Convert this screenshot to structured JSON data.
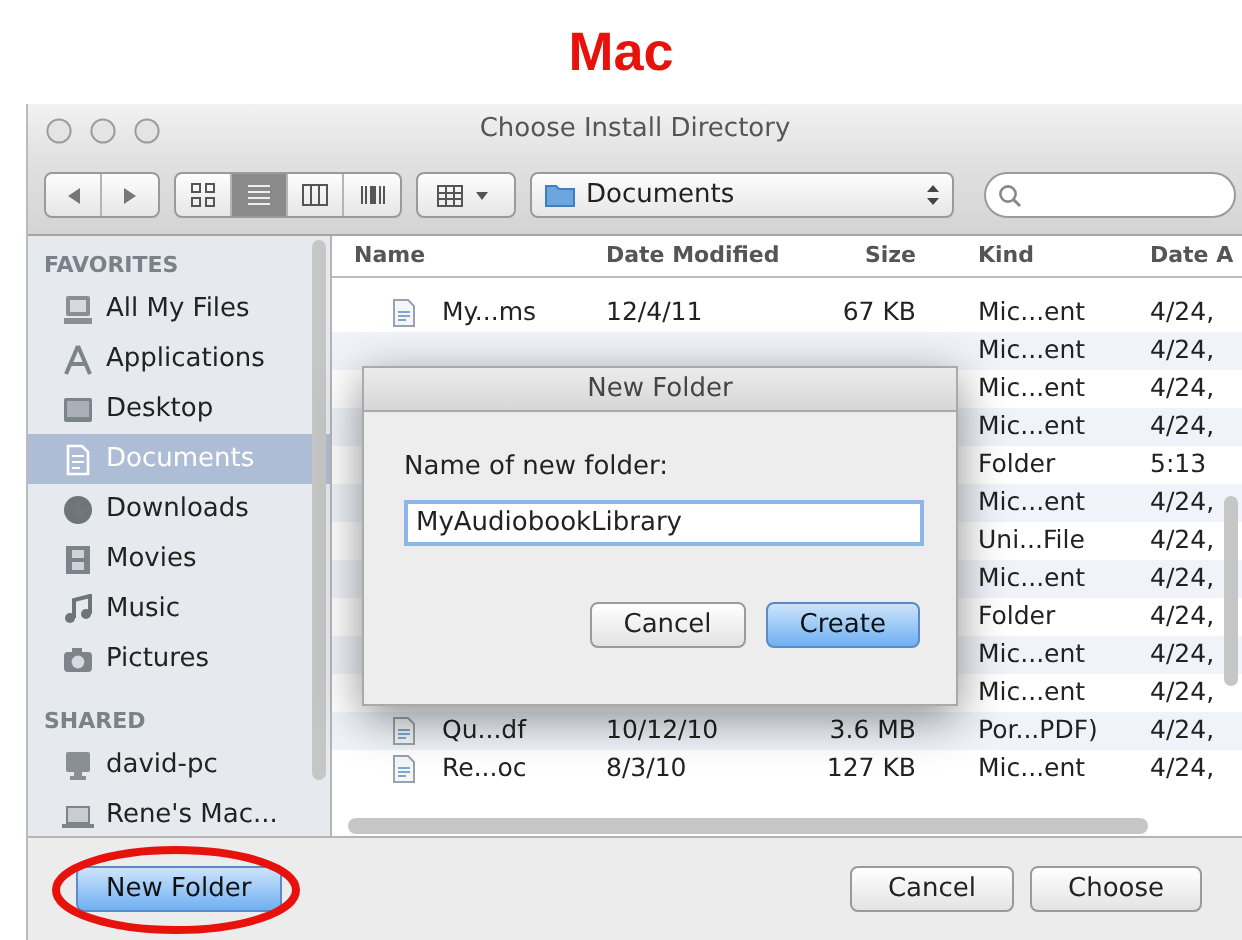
{
  "annotation": {
    "title": "Mac"
  },
  "window": {
    "title": "Choose Install Directory"
  },
  "toolbar": {
    "views": [
      {
        "selected": false
      },
      {
        "selected": true
      },
      {
        "selected": false
      },
      {
        "selected": false
      }
    ],
    "path_popup": "Documents"
  },
  "sidebar": {
    "sections": [
      {
        "heading": "FAVORITES",
        "items": [
          {
            "label": "All My Files",
            "selected": false
          },
          {
            "label": "Applications",
            "selected": false
          },
          {
            "label": "Desktop",
            "selected": false
          },
          {
            "label": "Documents",
            "selected": true
          },
          {
            "label": "Downloads",
            "selected": false
          },
          {
            "label": "Movies",
            "selected": false
          },
          {
            "label": "Music",
            "selected": false
          },
          {
            "label": "Pictures",
            "selected": false
          }
        ]
      },
      {
        "heading": "SHARED",
        "items": [
          {
            "label": "david-pc",
            "selected": false
          },
          {
            "label": "Rene's Mac...",
            "selected": false
          }
        ]
      }
    ]
  },
  "file_list": {
    "columns": [
      "Name",
      "Date Modified",
      "Size",
      "Kind",
      "Date A"
    ],
    "rows": [
      {
        "name": "My...ms",
        "date_modified": "12/4/11",
        "size": "67 KB",
        "kind": "Mic...ent",
        "date_added": "4/24,"
      },
      {
        "kind": "Mic...ent",
        "date_added": "4/24,"
      },
      {
        "kind": "Mic...ent",
        "date_added": "4/24,"
      },
      {
        "kind": "Mic...ent",
        "date_added": "4/24,"
      },
      {
        "kind": "Folder",
        "date_added": "5:13"
      },
      {
        "kind": "Mic...ent",
        "date_added": "4/24,"
      },
      {
        "kind": "Uni...File",
        "date_added": "4/24,"
      },
      {
        "kind": "Mic...ent",
        "date_added": "4/24,"
      },
      {
        "kind": "Folder",
        "date_added": "4/24,"
      },
      {
        "kind": "Mic...ent",
        "date_added": "4/24,"
      },
      {
        "kind": "Mic...ent",
        "date_added": "4/24,"
      },
      {
        "name": "Qu...df",
        "date_modified": "10/12/10",
        "size": "3.6 MB",
        "kind": "Por...PDF)",
        "date_added": "4/24,"
      },
      {
        "name": "Re...oc",
        "date_modified": "8/3/10",
        "size": "127 KB",
        "kind": "Mic...ent",
        "date_added": "4/24,"
      }
    ]
  },
  "dialog": {
    "title": "New Folder",
    "label": "Name of new folder:",
    "value": "MyAudiobookLibrary",
    "buttons": [
      {
        "label": "Cancel",
        "default": false
      },
      {
        "label": "Create",
        "default": true
      }
    ]
  },
  "bottom_bar": {
    "left_buttons": [
      {
        "label": "New Folder",
        "default": true
      }
    ],
    "right_buttons": [
      {
        "label": "Cancel",
        "default": false
      },
      {
        "label": "Choose",
        "default": false
      }
    ]
  }
}
